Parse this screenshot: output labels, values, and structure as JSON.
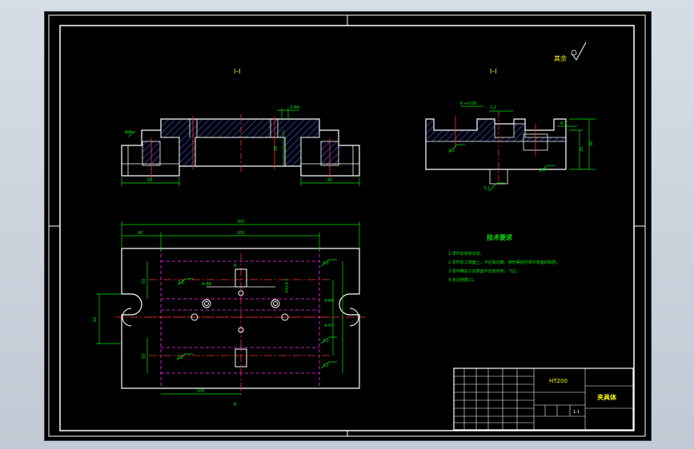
{
  "drawing": {
    "section_a_label": "I–I",
    "section_b_label": "I–I",
    "roughness_note": "其余",
    "tech_req": {
      "title": "技术要求",
      "lines": [
        "1.零件去除氧化皮。",
        "2.零件加工表面上，不应有划痕、擦伤等损伤零件表面的缺陷。",
        "3.零件精加工前表面不应有毛刺、飞边。",
        "4.未注倒角C1。"
      ]
    },
    "title_block": {
      "material": "HT200",
      "part_name": "夹具体",
      "scale": "1:1"
    }
  },
  "colors": {
    "background": "#000000",
    "outline": "#ffffff",
    "dimension": "#00e600",
    "centerline": "#ff3030",
    "hatch": "#3b5bff",
    "hidden": "#ff30ff",
    "text_yellow": "#ffff00"
  }
}
